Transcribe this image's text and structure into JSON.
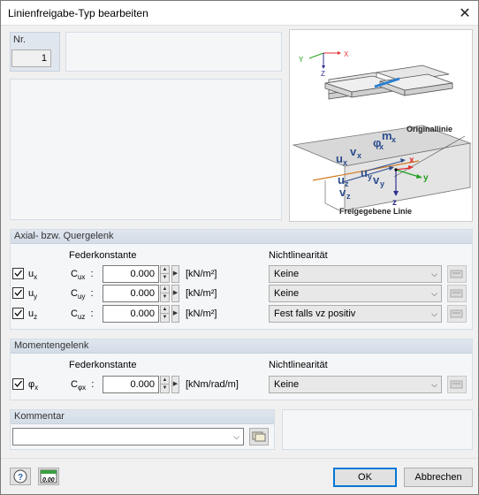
{
  "window": {
    "title": "Linienfreigabe-Typ bearbeiten"
  },
  "nr": {
    "label": "Nr.",
    "value": "1"
  },
  "diagram": {
    "original_line": "Originallinie",
    "released_line": "Freigegebene Linie",
    "axis_x": "x",
    "axis_y": "y",
    "axis_z": "z",
    "small_axis_x": "X",
    "small_axis_y": "Y",
    "small_axis_z": "Z",
    "symbols": {
      "ux": "u",
      "ux_sub": "x",
      "vx": "v",
      "vx_sub": "x",
      "uy": "u",
      "uy_sub": "y",
      "vy": "v",
      "vy_sub": "y",
      "uz": "u",
      "uz_sub": "z",
      "vz": "v",
      "vz_sub": "z",
      "phix": "φ",
      "phix_sub": "x",
      "mx": "m",
      "mx_sub": "x"
    }
  },
  "axial": {
    "title": "Axial- bzw. Quergelenk",
    "spring_header": "Federkonstante",
    "nonlin_header": "Nichtlinearität",
    "rows": [
      {
        "name": "u",
        "sub": "x",
        "const": "C",
        "const_sub": "ux",
        "value": "0.000",
        "unit": "[kN/m²]",
        "nonlin": "Keine",
        "checked": true
      },
      {
        "name": "u",
        "sub": "y",
        "const": "C",
        "const_sub": "uy",
        "value": "0.000",
        "unit": "[kN/m²]",
        "nonlin": "Keine",
        "checked": true
      },
      {
        "name": "u",
        "sub": "z",
        "const": "C",
        "const_sub": "uz",
        "value": "0.000",
        "unit": "[kN/m²]",
        "nonlin": "Fest falls vz positiv",
        "checked": true
      }
    ]
  },
  "moment": {
    "title": "Momentengelenk",
    "spring_header": "Federkonstante",
    "nonlin_header": "Nichtlinearität",
    "row": {
      "name": "φ",
      "sub": "x",
      "const": "C",
      "const_sub": "φx",
      "value": "0.000",
      "unit": "[kNm/rad/m]",
      "nonlin": "Keine",
      "checked": true
    }
  },
  "comment": {
    "title": "Kommentar",
    "value": ""
  },
  "buttons": {
    "ok": "OK",
    "cancel": "Abbrechen",
    "units_icon_text": "0.00"
  }
}
